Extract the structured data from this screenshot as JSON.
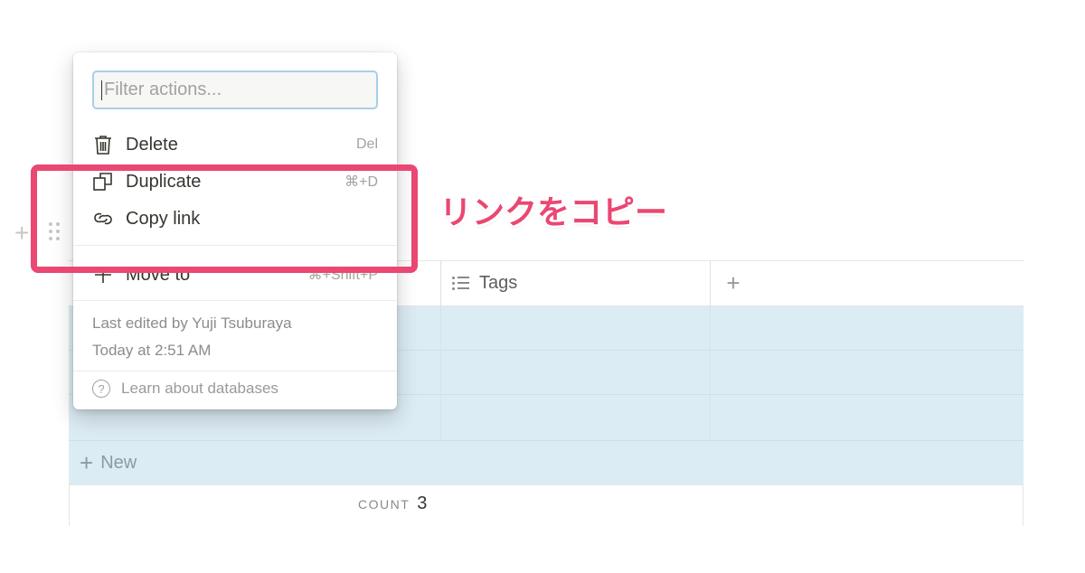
{
  "table": {
    "tags_header": "Tags",
    "add_column_label": "+",
    "new_row_label": "New",
    "count_label": "COUNT",
    "count_value": "3",
    "row_add_label": "+"
  },
  "menu": {
    "filter_placeholder": "Filter actions...",
    "items": [
      {
        "label": "Delete",
        "shortcut": "Del",
        "icon": "trash-icon"
      },
      {
        "label": "Duplicate",
        "shortcut": "⌘+D",
        "icon": "duplicate-icon"
      },
      {
        "label": "Copy link",
        "shortcut": "",
        "icon": "link-icon"
      },
      {
        "label": "Move to",
        "shortcut": "⌘+Shift+P",
        "icon": "move-icon"
      }
    ],
    "last_edited": "Last edited by Yuji Tsuburaya",
    "edited_time": "Today at 2:51 AM",
    "learn_link": "Learn about databases"
  },
  "annotation": {
    "text": "リンクをコピー",
    "color": "#ea4772"
  },
  "colors": {
    "selection": "#dcecf4",
    "focus_ring": "#a7cfe9"
  }
}
